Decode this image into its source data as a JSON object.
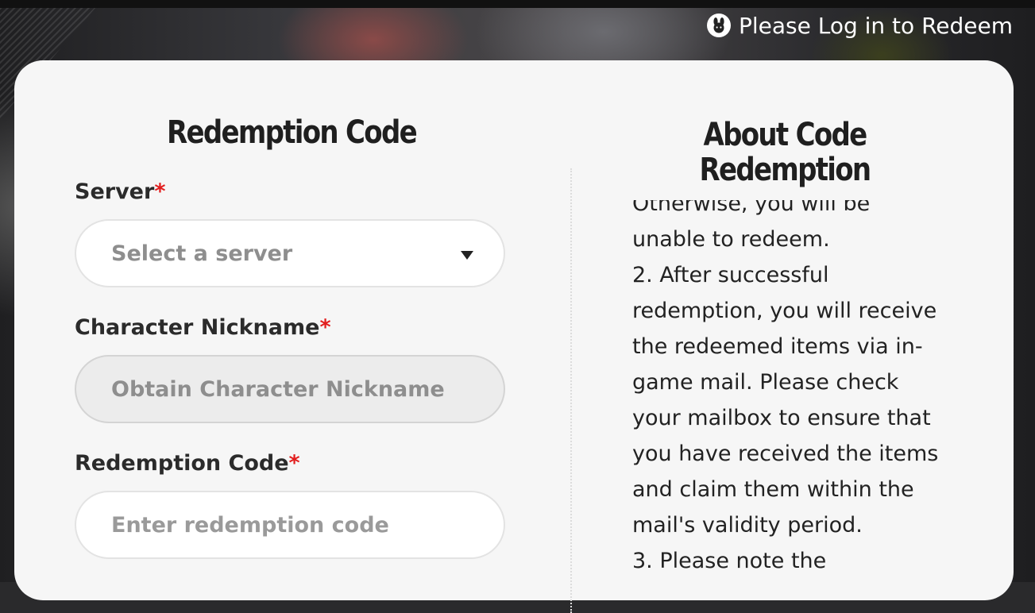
{
  "header": {
    "login_text": "Please Log in to Redeem",
    "login_icon": "bunny-avatar-icon"
  },
  "form": {
    "title": "Redemption Code",
    "server_label": "Server",
    "server_placeholder": "Select a server",
    "nickname_label": "Character Nickname",
    "nickname_placeholder": "Obtain Character Nickname",
    "code_label": "Redemption Code",
    "code_placeholder": "Enter redemption code",
    "required_mark": "*"
  },
  "about": {
    "title_line1": "About Code",
    "title_line2": "Redemption",
    "lines": [
      "Otherwise, you will be",
      "unable to redeem.",
      "2. After successful",
      "redemption, you will receive",
      "the redeemed items via in-",
      "game mail. Please check",
      "your mailbox to ensure that",
      "you have received the items",
      "and claim them within the",
      "mail's validity period.",
      "3. Please note the"
    ]
  },
  "colors": {
    "card_bg": "#f6f6f6",
    "required": "#e21d1d",
    "text_dark": "#1f1f1f",
    "placeholder": "#8e8e8e"
  }
}
